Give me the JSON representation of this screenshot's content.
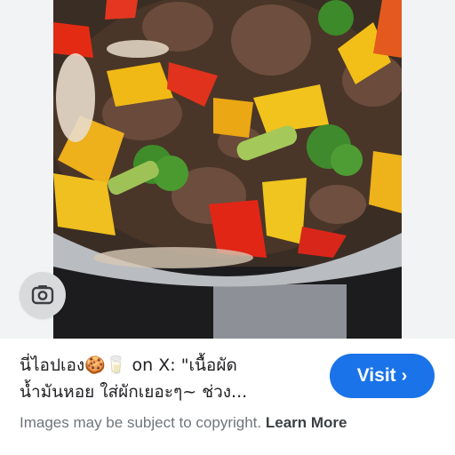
{
  "result": {
    "caption_line1": "นี่ไอปเอง🍪🥛 on X: \"เนื้อผัด",
    "caption_line2": "น้ำมันหอย ใส่ผักเยอะๆ~ ช่วง...",
    "visit_label": "Visit",
    "visit_chevron": "›"
  },
  "footer": {
    "copyright_text": "Images may be subject to copyright.",
    "learn_more_label": "Learn More"
  },
  "icons": {
    "lens": "lens-icon",
    "chevron": "chevron-right-icon"
  },
  "colors": {
    "accent": "#1a73e8",
    "lens_bg": "#d9dadb",
    "muted_text": "#70757a"
  }
}
